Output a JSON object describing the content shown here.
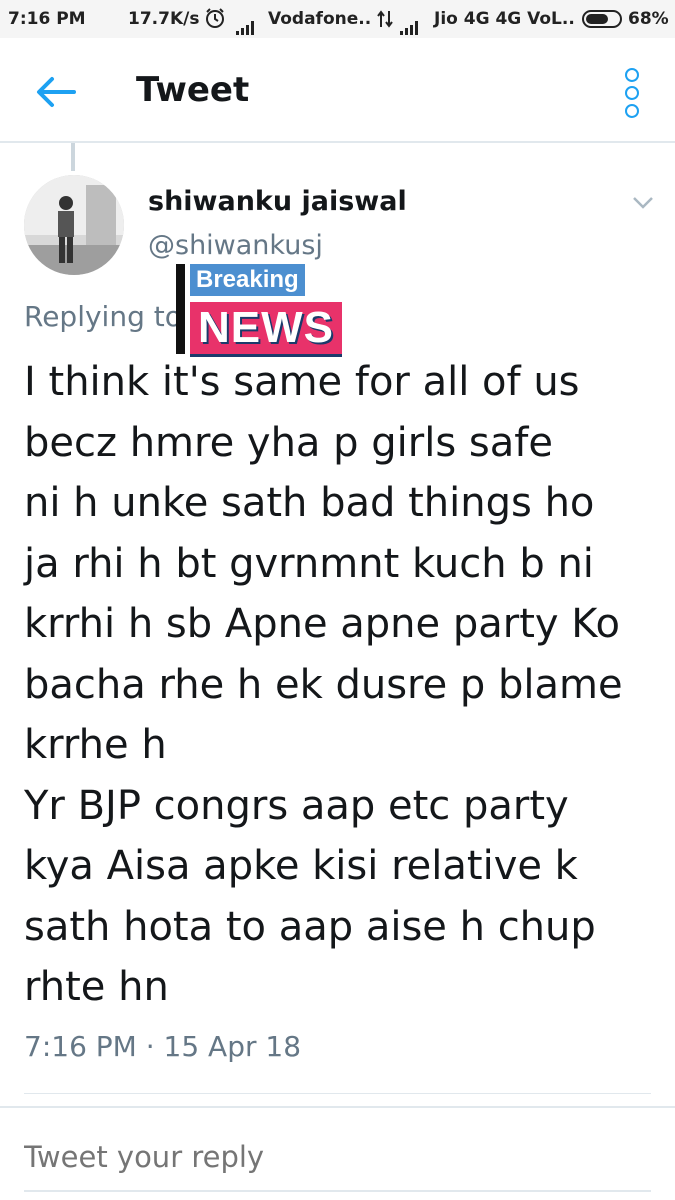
{
  "status_bar": {
    "time": "7:16 PM",
    "speed": "17.7K/s",
    "carrier1": "Vodafone..",
    "carrier2": "Jio 4G 4G VoL..",
    "battery": "68%",
    "battery_level": 0.68
  },
  "header": {
    "title": "Tweet",
    "back_icon": "arrow-left-icon",
    "more_icon": "vertical-dots-icon",
    "accent_color": "#1da1f2"
  },
  "tweet": {
    "author_name": "shiwanku jaiswal",
    "author_handle": "@shiwankusj",
    "replying_to": "Replying to",
    "overlay_top": "Breaking",
    "overlay_bottom": "NEWS",
    "text_lines": [
      "I think it's same for all of us",
      "becz hmre yha p girls safe",
      "ni h unke sath bad things ho",
      "ja rhi h bt gvrnmnt kuch b ni",
      "krrhi h sb Apne apne party Ko",
      "bacha rhe h ek dusre p blame",
      "krrhe h",
      "Yr BJP congrs aap etc party",
      "kya Aisa apke kisi relative k",
      "sath hota to aap aise h chup",
      "rhte hn"
    ],
    "timestamp": "7:16 PM · 15 Apr 18"
  },
  "reply": {
    "placeholder": "Tweet your reply"
  }
}
